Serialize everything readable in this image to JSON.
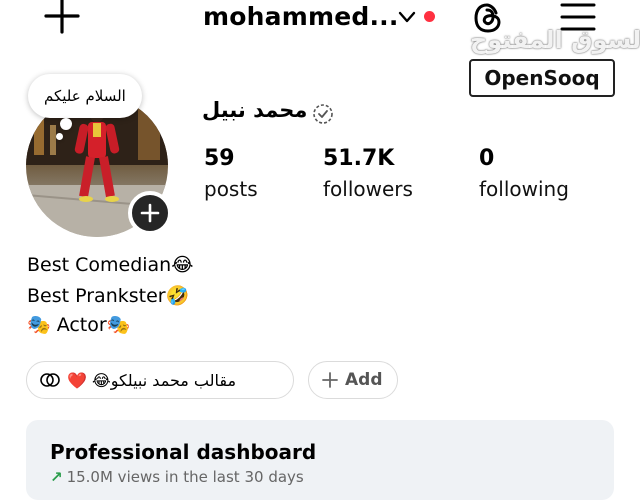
{
  "header": {
    "username": "mohammed...",
    "has_notification_dot": true,
    "icons": [
      "plus-icon",
      "chevron-down-icon",
      "threads-icon",
      "menu-icon"
    ]
  },
  "watermark": {
    "arabic": "السوق المفتوح",
    "brand": "OpenSooq"
  },
  "profile": {
    "note": "السلام عليكم",
    "full_name": "محمد نبيل",
    "stats": {
      "posts_count": "59",
      "posts_label": "posts",
      "followers_count": "51.7K",
      "followers_label": "followers",
      "following_count": "0",
      "following_label": "following"
    },
    "bio": {
      "line1": "Best Comedian😂",
      "line2": "Best Prankster🤣",
      "line3": "🎭 Actor🎭"
    }
  },
  "chips": {
    "link_text": "مقالب محمد نبيلكو😂 ❤️",
    "add_label": "Add"
  },
  "dashboard": {
    "title": "Professional dashboard",
    "subtitle": "15.0M views in the last 30 days",
    "arrow": "↗"
  },
  "colors": {
    "notification": "#ff3040",
    "dashboard_bg": "#eff2f5",
    "trend_green": "#2a9d4b"
  }
}
